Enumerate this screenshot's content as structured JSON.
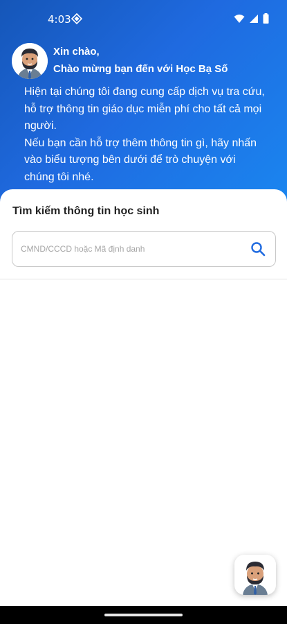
{
  "status_bar": {
    "time": "4:03",
    "icons": [
      "settings-diamond-icon",
      "wifi-icon",
      "cellular-signal-icon",
      "battery-icon"
    ]
  },
  "greeting": {
    "title": "Xin chào,",
    "subtitle": "Chào mừng bạn đến với Học Bạ Số",
    "intro_line1": "Hiện tại chúng tôi đang cung cấp dịch vụ tra cứu, hỗ trợ thông tin giáo dục miễn phí cho tất cả mọi người.",
    "intro_line2": "Nếu bạn cần hỗ trợ thêm thông tin gì, hãy nhấn vào biểu tượng bên dưới để trò chuyện với chúng tôi nhé."
  },
  "search": {
    "title": "Tìm kiếm thông tin học sinh",
    "placeholder": "CMND/CCCD hoặc Mã định danh",
    "value": ""
  },
  "colors": {
    "header_start": "#1556b8",
    "header_end": "#1a86f0",
    "search_icon": "#1f6ae0"
  },
  "icons": {
    "avatar": "male-avatar-icon",
    "search": "search-icon",
    "chat_fab": "chat-avatar-icon"
  }
}
